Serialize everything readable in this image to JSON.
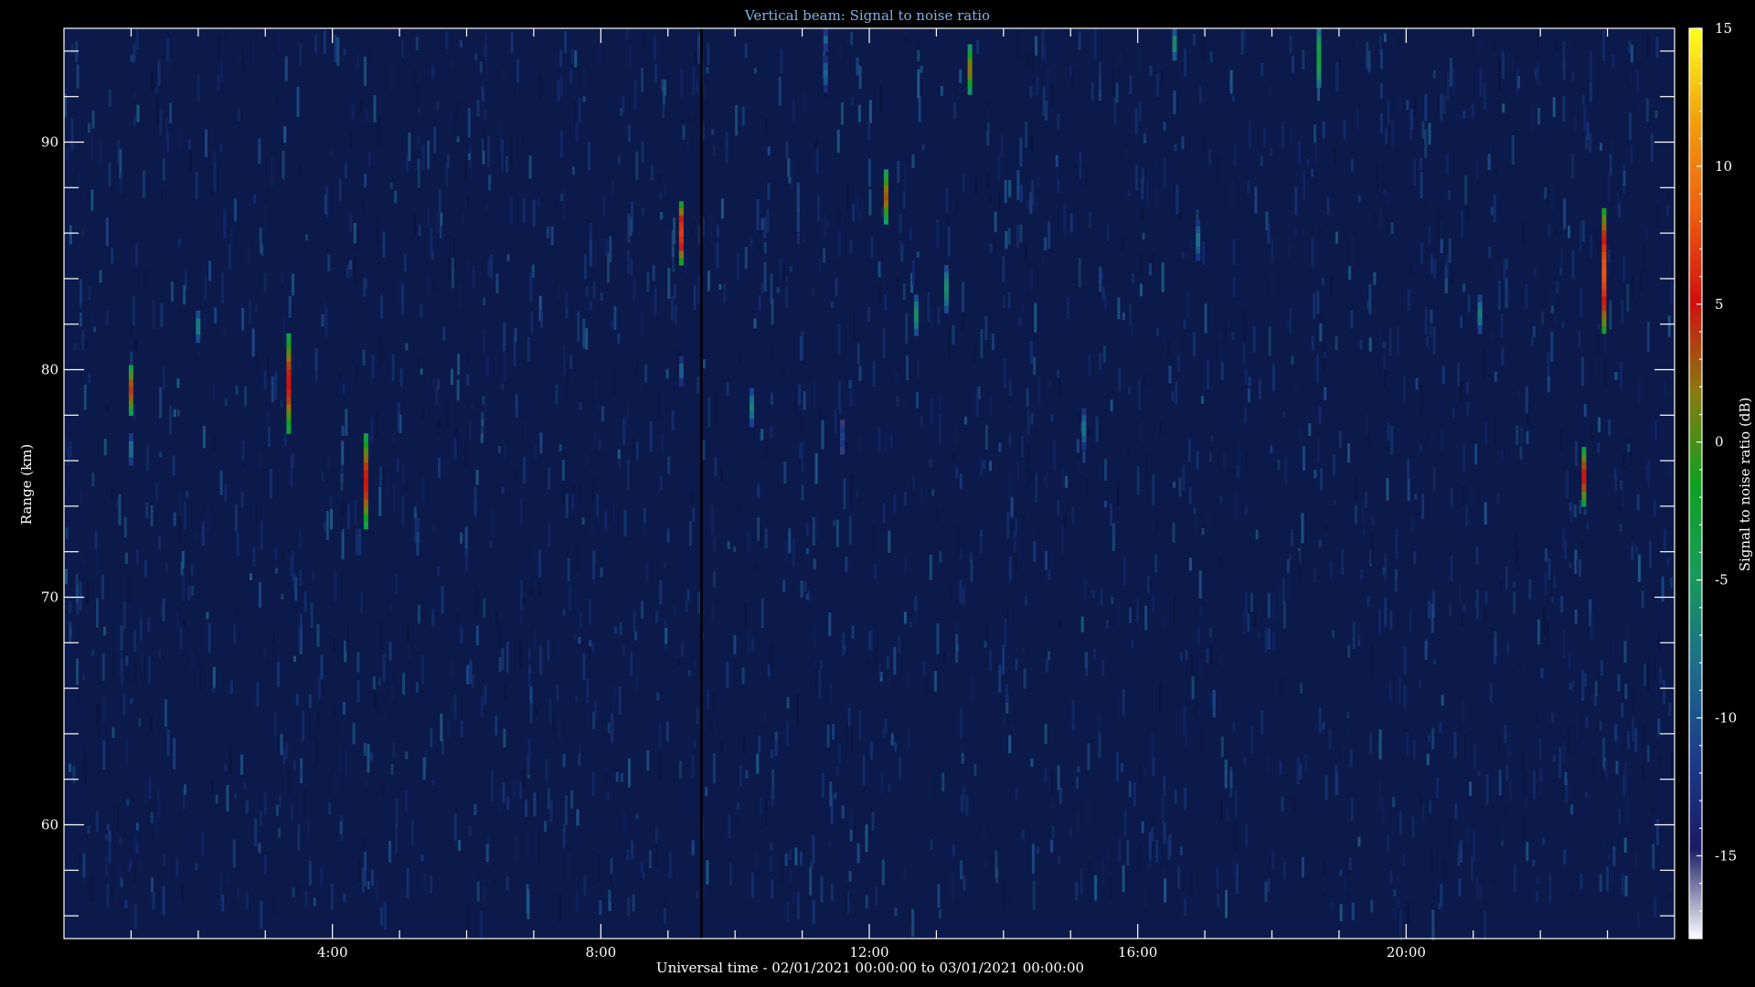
{
  "chart_data": {
    "type": "heatmap",
    "title": "Vertical beam: Signal to noise ratio",
    "xlabel": "Universal time - 02/01/2021 00:00:00 to 03/01/2021 00:00:00",
    "ylabel": "Range (km)",
    "x_unit": "hours UT",
    "xlim": [
      0,
      24
    ],
    "ylim": [
      55,
      95
    ],
    "x_tick_labels": [
      "4:00",
      "8:00",
      "12:00",
      "16:00",
      "20:00"
    ],
    "x_ticks": [
      4,
      8,
      12,
      16,
      20
    ],
    "y_ticks": [
      60,
      70,
      80,
      90
    ],
    "y_tick_labels": [
      "60",
      "70",
      "80",
      "90"
    ],
    "background_color": "#0b1a4a",
    "data_gap_time": 9.5,
    "colorbar": {
      "label": "Signal to noise ratio (dB)",
      "range": [
        -18,
        15
      ],
      "ticks": [
        -15,
        -10,
        -5,
        0,
        5,
        10,
        15
      ],
      "tick_labels": [
        "-15",
        "-10",
        "-5",
        "0",
        "5",
        "10",
        "15"
      ],
      "colors": [
        "#ffffff",
        "#1a1a66",
        "#1c3c8c",
        "#1c6e8c",
        "#1a9a5a",
        "#10a020",
        "#8a7a10",
        "#d01010",
        "#ee6010",
        "#f0a010",
        "#ffff20"
      ]
    },
    "echoes": [
      {
        "t": 1.0,
        "r0": 78.0,
        "r1": 80.2,
        "snr": 0
      },
      {
        "t": 1.0,
        "r0": 75.8,
        "r1": 77.2,
        "snr": -8
      },
      {
        "t": 2.0,
        "r0": 81.2,
        "r1": 82.6,
        "snr": -7
      },
      {
        "t": 3.35,
        "r0": 77.2,
        "r1": 81.6,
        "snr": 1
      },
      {
        "t": 4.5,
        "r0": 73.0,
        "r1": 77.2,
        "snr": 1
      },
      {
        "t": 9.2,
        "r0": 84.6,
        "r1": 87.4,
        "snr": 3
      },
      {
        "t": 9.2,
        "r0": 79.3,
        "r1": 80.6,
        "snr": -9
      },
      {
        "t": 10.25,
        "r0": 77.5,
        "r1": 79.2,
        "snr": -7
      },
      {
        "t": 11.35,
        "r0": 92.2,
        "r1": 93.8,
        "snr": -9
      },
      {
        "t": 11.35,
        "r0": 94.0,
        "r1": 95.0,
        "snr": -9
      },
      {
        "t": 12.25,
        "r0": 86.4,
        "r1": 88.8,
        "snr": -1
      },
      {
        "t": 12.7,
        "r0": 81.5,
        "r1": 83.3,
        "snr": -6
      },
      {
        "t": 13.15,
        "r0": 82.5,
        "r1": 84.6,
        "snr": -6
      },
      {
        "t": 13.5,
        "r0": 92.1,
        "r1": 94.3,
        "snr": -2
      },
      {
        "t": 15.2,
        "r0": 76.5,
        "r1": 78.3,
        "snr": -8
      },
      {
        "t": 16.55,
        "r0": 93.6,
        "r1": 95.0,
        "snr": -6
      },
      {
        "t": 16.9,
        "r0": 84.8,
        "r1": 86.6,
        "snr": -8
      },
      {
        "t": 18.7,
        "r0": 92.4,
        "r1": 95.0,
        "snr": -3
      },
      {
        "t": 21.1,
        "r0": 81.6,
        "r1": 83.3,
        "snr": -7
      },
      {
        "t": 22.65,
        "r0": 74.0,
        "r1": 76.6,
        "snr": 1
      },
      {
        "t": 22.95,
        "r0": 81.6,
        "r1": 87.1,
        "snr": 4
      },
      {
        "t": 11.6,
        "r0": 76.3,
        "r1": 77.8,
        "snr": -11
      }
    ]
  }
}
